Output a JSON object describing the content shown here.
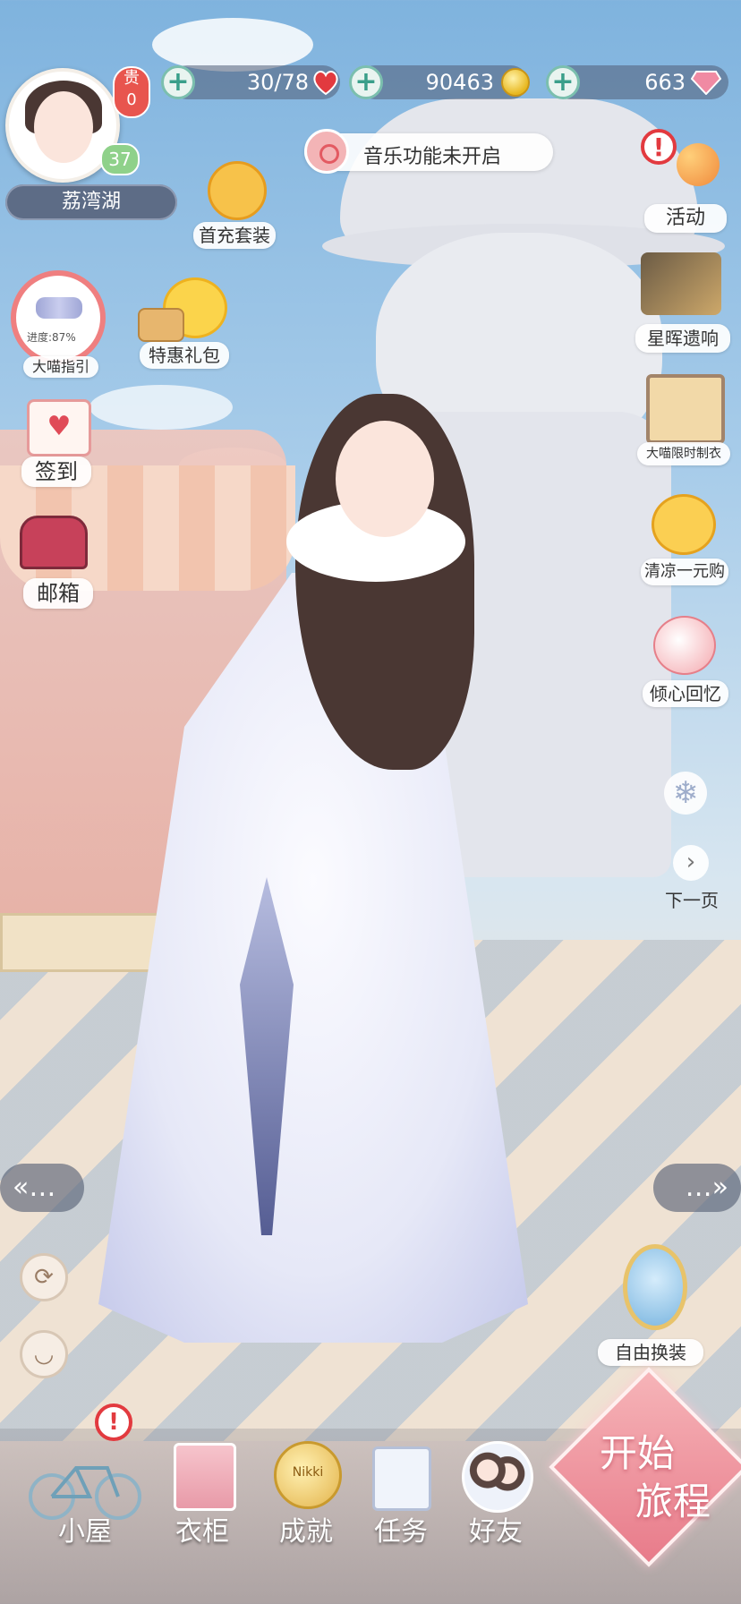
{
  "profile": {
    "name": "荔湾湖",
    "level": "37",
    "vip_label": "贵",
    "vip_level": "0"
  },
  "resources": {
    "stamina": "30/78",
    "coins": "90463",
    "diamonds": "663"
  },
  "music_notice": "音乐功能未开启",
  "left_menu": {
    "first_recharge": "首充套装",
    "guide_progress": "进度:87%",
    "guide_label": "大喵指引",
    "special_pack": "特惠礼包",
    "checkin": "签到",
    "mailbox": "邮箱"
  },
  "right_menu": {
    "events": "活动",
    "starlight": "星晖遗响",
    "limited_outfit": "大喵限时制衣",
    "one_yuan": "清凉一元购",
    "memory": "倾心回忆",
    "next_page": "下一页",
    "free_dress": "自由换装"
  },
  "bottom_nav": {
    "house": "小屋",
    "wardrobe": "衣柜",
    "achievement": "成就",
    "achievement_badge": "Nikki",
    "tasks": "任务",
    "friends": "好友",
    "start_line1": "开始",
    "start_line2": "旅程"
  },
  "colors": {
    "accent_teal": "#7bbfae",
    "alert_red": "#e8554e",
    "level_green": "#8fd18a",
    "start_pink": "#e87b8a"
  }
}
